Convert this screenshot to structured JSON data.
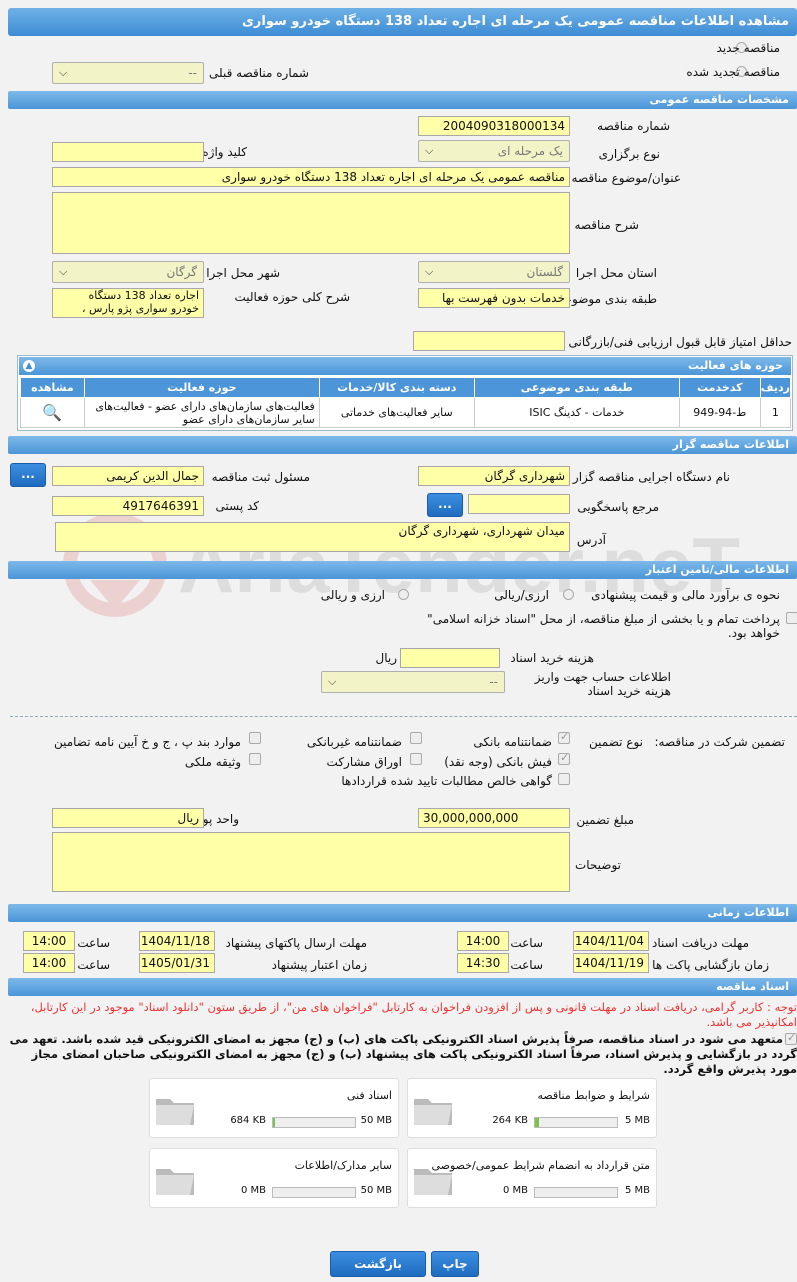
{
  "title": "مشاهده اطلاعات مناقصه عمومی یک مرحله ای اجاره تعداد 138 دستگاه خودرو سواری",
  "top": {
    "new_label": "مناقصه جدید",
    "renewed_label": "مناقصه تجدید شده",
    "prev_label": "شماره مناقصه قبلی",
    "prev_value": "--"
  },
  "general": {
    "section": "مشخصات مناقصه عمومی",
    "number_label": "شماره مناقصه",
    "number": "2004090318000134",
    "type_label": "نوع برگزاری",
    "type": "یک مرحله ای",
    "keyword_label": "کلید واژه",
    "keyword": "",
    "subject_label": "عنوان/موضوع مناقصه",
    "subject": "مناقصه عمومی یک مرحله ای اجاره تعداد 138 دستگاه خودرو سواری",
    "desc_label": "شرح مناقصه",
    "desc": "",
    "province_label": "استان محل اجرا",
    "province": "گلستان",
    "city_label": "شهر محل اجرا",
    "city": "گرگان",
    "category_label": "طبقه بندی موضوعی",
    "category": "خدمات بدون فهرست بها",
    "scope_label": "شرح کلی حوزه فعالیت",
    "scope": "اجاره تعداد 138 دستگاه خودرو سواری پژو پارس ،",
    "min_score_label": "حداقل امتیاز قابل قبول ارزیابی فنی/بازرگانی",
    "min_score": ""
  },
  "activity": {
    "section": "حوزه های فعالیت",
    "headers": [
      "ردیف",
      "کدخدمت",
      "طبقه بندی موضوعی",
      "دسته بندی کالا/خدمات",
      "حوزه فعالیت",
      "مشاهده"
    ],
    "rows": [
      {
        "row": "1",
        "code": "ط-94-949",
        "category": "خدمات - کدینگ ISIC",
        "group": "سایر فعالیت‌های خدماتی",
        "field": "فعالیت‌های سازمان‌های دارای عضو - فعالیت‌های سایر سازمان‌های دارای عضو"
      }
    ]
  },
  "organizer": {
    "section": "اطلاعات مناقصه گزار",
    "org_label": "نام دستگاه اجرایی مناقصه گزار",
    "org": "شهرداری گرگان",
    "resp_label": "مسئول ثبت مناقصه",
    "resp": "جمال الدین کریمی",
    "ref_label": "مرجع پاسخگویی",
    "ref": "",
    "postal_label": "کد پستی",
    "postal": "4917646391",
    "addr_label": "آدرس",
    "addr": "میدان شهرداری، شهرداری گرگان",
    "btn": "..."
  },
  "finance": {
    "section": "اطلاعات مالی/تامین اعتبار",
    "estimate_label": "نحوه ی برآورد مالی و قیمت پیشنهادی",
    "opt1": "ارزی/ریالی",
    "opt2": "ارزی و ریالی",
    "treasury": "پرداخت تمام و یا بخشی از مبلغ مناقصه، از محل \"اسناد خزانه اسلامی\" خواهد بود.",
    "fee_label": "هزینه خرید اسناد",
    "fee": "",
    "fee_unit": "ریال",
    "account_label": "اطلاعات حساب جهت واریز هزینه خرید اسناد",
    "account": "--"
  },
  "guarantee": {
    "label": "تضمین شرکت در مناقصه:",
    "type_label": "نوع تضمین",
    "items": [
      "ضمانتنامه بانکی",
      "ضمانتنامه غیربانکی",
      "موارد بند پ ، ج و خ آیین نامه تضامین",
      "فیش بانکی (وجه نقد)",
      "اوراق مشارکت",
      "وثیقه ملکی",
      "گواهی خالص مطالبات تایید شده قراردادها"
    ],
    "amount_label": "مبلغ تضمین",
    "amount": "30,000,000,000",
    "unit_label": "واحد پول",
    "unit": "ریال",
    "notes_label": "توضیحات",
    "notes": ""
  },
  "timing": {
    "section": "اطلاعات زمانی",
    "doc_deadline_label": "مهلت دریافت اسناد",
    "doc_deadline": "1404/11/04",
    "doc_time": "14:00",
    "submit_label": "مهلت ارسال پاکتهای پیشنهاد",
    "submit": "1404/11/18",
    "submit_time": "14:00",
    "open_label": "زمان بازگشایی پاکت ها",
    "open": "1404/11/19",
    "open_time": "14:30",
    "validity_label": "زمان اعتبار پیشنهاد",
    "validity": "1405/01/31",
    "validity_time": "14:00",
    "time_label": "ساعت"
  },
  "docs": {
    "section": "اسناد مناقصه",
    "note": "توجه : کاربر گرامی، دریافت اسناد در مهلت قانونی و پس از افزودن فراخوان به کارتابل \"فراخوان های من\"، از طریق ستون \"دانلود اسناد\" موجود در این کارتابل، امکانپذیر می باشد.",
    "pledge": "متعهد می شود در اسناد مناقصه، صرفاً پذیرش اسناد الکترونیکی پاکت های (ب) و (ج) مجهز به امضای الکترونیکی قید شده باشد. تعهد می گردد در بازگشایی و پذیرش اسناد، صرفاً اسناد الکترونیکی پاکت های پیشنهاد (ب) و (ج) مجهز به امضای الکترونیکی صاحبان امضای مجاز مورد پذیرش واقع گردد.",
    "files": [
      {
        "name": "شرایط و ضوابط مناقصه",
        "size": "264 KB",
        "max": "5 MB",
        "fill": 0.05
      },
      {
        "name": "اسناد فنی",
        "size": "684 KB",
        "max": "50 MB",
        "fill": 0.02
      },
      {
        "name": "متن قرارداد به انضمام شرایط عمومی/خصوصی",
        "size": "0 MB",
        "max": "5 MB",
        "fill": 0
      },
      {
        "name": "سایر مدارک/اطلاعات",
        "size": "0 MB",
        "max": "50 MB",
        "fill": 0
      }
    ]
  },
  "buttons": {
    "print": "چاپ",
    "back": "بازگشت"
  },
  "watermark": "AriaTender.neT"
}
